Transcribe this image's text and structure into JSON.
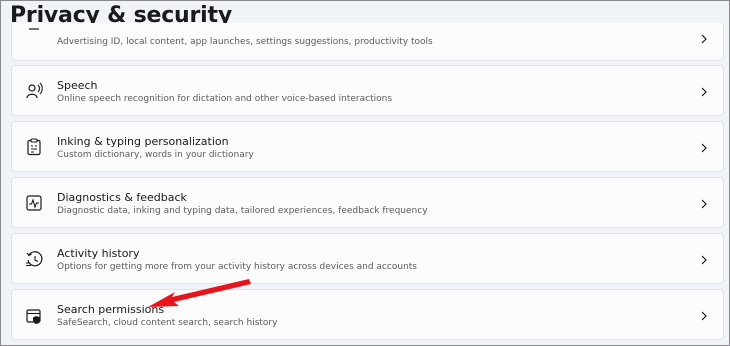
{
  "page_title": "Privacy & security",
  "items": [
    {
      "icon": "privacy-icon",
      "title": "",
      "subtitle": "Advertising ID, local content, app launches, settings suggestions, productivity tools"
    },
    {
      "icon": "speech-icon",
      "title": "Speech",
      "subtitle": "Online speech recognition for dictation and other voice-based interactions"
    },
    {
      "icon": "clipboard-icon",
      "title": "Inking & typing personalization",
      "subtitle": "Custom dictionary, words in your dictionary"
    },
    {
      "icon": "diagnostics-icon",
      "title": "Diagnostics & feedback",
      "subtitle": "Diagnostic data, inking and typing data, tailored experiences, feedback frequency"
    },
    {
      "icon": "history-icon",
      "title": "Activity history",
      "subtitle": "Options for getting more from your activity history across devices and accounts"
    },
    {
      "icon": "search-permissions-icon",
      "title": "Search permissions",
      "subtitle": "SafeSearch, cloud content search, search history"
    }
  ],
  "colors": {
    "annotation_arrow": "#e8141c"
  }
}
